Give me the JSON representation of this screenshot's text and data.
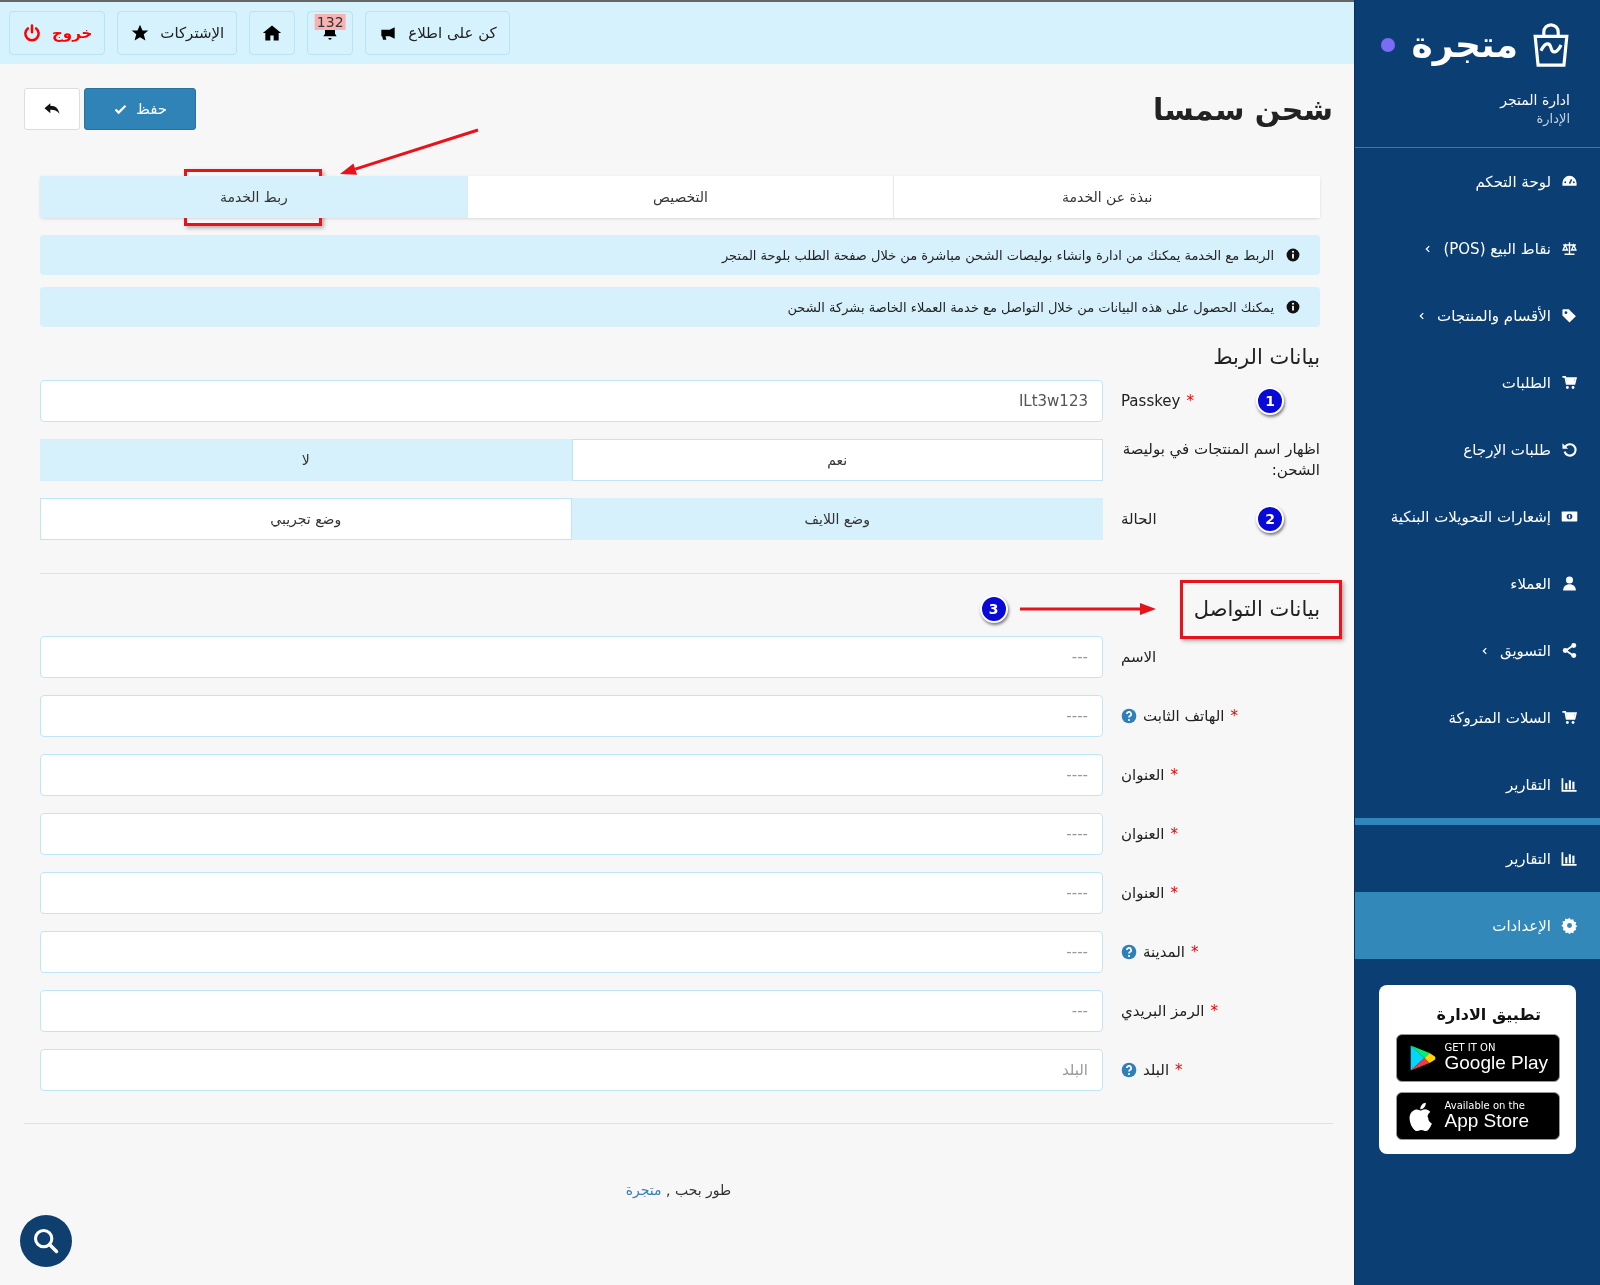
{
  "topbar": {
    "buttons": [
      {
        "kind": "announce",
        "label": "كن على اطلاع"
      },
      {
        "kind": "notifications",
        "badge": "132"
      },
      {
        "kind": "home"
      },
      {
        "kind": "subscriptions",
        "label": "الإشتركات"
      },
      {
        "kind": "logout",
        "label": "خروج"
      }
    ]
  },
  "page": {
    "title": "شحن سمسا",
    "save_label": "حفظ"
  },
  "tabs": [
    {
      "label": "نبذة عن الخدمة",
      "selected": false,
      "highlighted": false
    },
    {
      "label": "التخصيص",
      "selected": false,
      "highlighted": false
    },
    {
      "label": "ربط الخدمة",
      "selected": true,
      "highlighted": true
    }
  ],
  "alerts": [
    "الربط مع الخدمة يمكنك من ادارة وانشاء بوليصات الشحن مباشرة من خلال صفحة الطلب بلوحة المتجر",
    "يمكنك الحصول على هذه البيانات من خلال التواصل مع خدمة العملاء الخاصة بشركة الشحن"
  ],
  "sections": [
    {
      "heading": "بيانات الربط",
      "highlighted": false,
      "rows": [
        {
          "kind": "input",
          "label": "Passkey",
          "asterisk": "*",
          "marker": "1",
          "value": "ILt3w123"
        },
        {
          "kind": "toggle",
          "label": "اظهار اسم المنتجات في بوليصة الشحن:",
          "options": [
            {
              "label": "نعم",
              "selected": false
            },
            {
              "label": "لا",
              "selected": true
            }
          ]
        },
        {
          "kind": "toggle",
          "label": "الحالة",
          "marker": "2",
          "options": [
            {
              "label": "وضع اللايف",
              "selected": true
            },
            {
              "label": "وضع تجريبي",
              "selected": false
            }
          ]
        }
      ]
    },
    {
      "heading": "بيانات التواصل",
      "highlighted": true,
      "marker": "3",
      "rows": [
        {
          "kind": "input",
          "label": "الاسم",
          "placeholder": "---"
        },
        {
          "kind": "input",
          "label": "الهاتف الثابت",
          "asterisk": "*",
          "help": true,
          "placeholder": "----"
        },
        {
          "kind": "input",
          "label": "العنوان",
          "asterisk": "*",
          "placeholder": "----"
        },
        {
          "kind": "input",
          "label": "العنوان",
          "asterisk": "*",
          "placeholder": "----"
        },
        {
          "kind": "input",
          "label": "العنوان",
          "asterisk": "*",
          "placeholder": "----"
        },
        {
          "kind": "input",
          "label": "المدينة",
          "asterisk": "*",
          "help": true,
          "placeholder": "----"
        },
        {
          "kind": "input",
          "label": "الرمز البريدي",
          "asterisk": "*",
          "placeholder": "---"
        },
        {
          "kind": "input",
          "label": "البلد",
          "asterisk": "*",
          "help": true,
          "placeholder": "البلد"
        }
      ]
    }
  ],
  "footer": {
    "text": "طور بحب ,",
    "link": "متجرة"
  },
  "sidebar": {
    "brand": "متجرة",
    "store_name": "ادارة المتجر",
    "role": "الإدارة",
    "items": [
      {
        "label": "لوحة التحكم",
        "submenu": false,
        "selected": false
      },
      {
        "label": "نقاط البيع (POS)",
        "submenu": true,
        "selected": false
      },
      {
        "label": "الأقسام والمنتجات",
        "submenu": true,
        "selected": false
      },
      {
        "label": "الطلبات",
        "submenu": false,
        "selected": false
      },
      {
        "label": "طلبات الإرجاع",
        "submenu": false,
        "selected": false
      },
      {
        "label": "إشعارات التحويلات البنكية",
        "submenu": false,
        "selected": false
      },
      {
        "label": "العملاء",
        "submenu": false,
        "selected": false
      },
      {
        "label": "التسويق",
        "submenu": true,
        "selected": false
      },
      {
        "label": "السلات المتروكة",
        "submenu": false,
        "selected": false
      },
      {
        "label": "التقارير",
        "submenu": false,
        "selected": false
      },
      {
        "label": "التقارير",
        "submenu": false,
        "selected": false,
        "divider_before": true
      },
      {
        "label": "الإعدادات",
        "submenu": false,
        "selected": true
      }
    ],
    "app_card": {
      "title": "تطبيق الادارة",
      "badges": [
        {
          "kind": "google",
          "small": "GET IT ON",
          "big": "Google Play"
        },
        {
          "kind": "apple",
          "small": "Available on the",
          "big": "App Store"
        }
      ]
    }
  }
}
